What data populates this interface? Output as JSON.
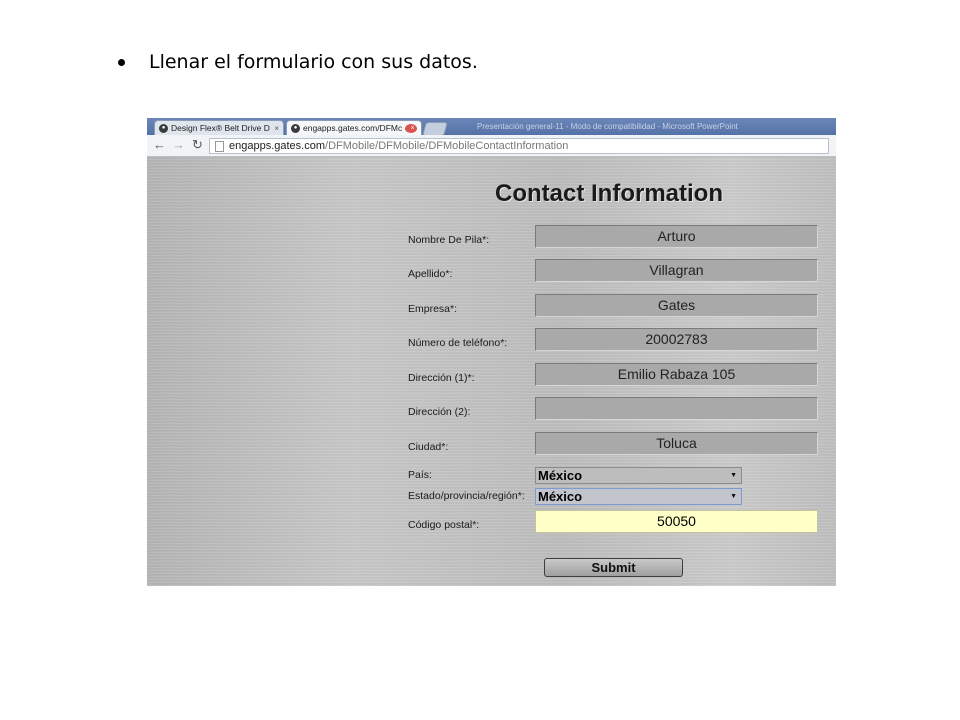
{
  "slide": {
    "bullet_text": "Llenar el formulario con sus datos."
  },
  "browser": {
    "tabs": [
      {
        "title": "Design Flex® Belt Drive D",
        "icon": "gates-logo-icon"
      },
      {
        "title": "engapps.gates.com/DFMc",
        "icon": "gates-logo-icon"
      }
    ],
    "background_window_title": "Presentación general-11 - Modo de compatibilidad - Microsoft PowerPoint",
    "url_host": "engapps.gates.com",
    "url_path": "/DFMobile/DFMobile/DFMobileContactInformation"
  },
  "form": {
    "title": "Contact Information",
    "fields": [
      {
        "label": "Nombre De Pila*:",
        "value": "Arturo"
      },
      {
        "label": "Apellido*:",
        "value": "Villagran"
      },
      {
        "label": "Empresa*:",
        "value": "Gates"
      },
      {
        "label": "Número de teléfono*:",
        "value": "20002783"
      },
      {
        "label": "Dirección (1)*:",
        "value": "Emilio Rabaza 105"
      },
      {
        "label": "Dirección (2):",
        "value": ""
      },
      {
        "label": "Ciudad*:",
        "value": "Toluca"
      }
    ],
    "country": {
      "label": "País:",
      "value": "México"
    },
    "state": {
      "label": "Estado/provincia/región*:",
      "value": "México"
    },
    "postal": {
      "label": "Código postal*:",
      "value": "50050"
    },
    "submit_label": "Submit"
  },
  "colors": {
    "field_bg": "#a9a9a9",
    "postal_bg": "#ffffc8",
    "tabstrip": "#5572a8"
  }
}
